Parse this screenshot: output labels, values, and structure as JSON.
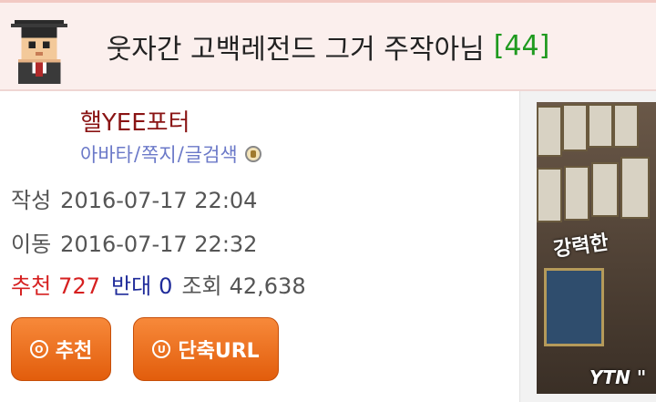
{
  "post": {
    "title": "웃자간 고백레전드 그거 주작아님",
    "comment_count": "[44]"
  },
  "author": {
    "nickname": "핼YEE포터",
    "links": [
      "아바타",
      "쪽지",
      "글검색"
    ]
  },
  "meta": {
    "written_label": "작성",
    "written": "2016-07-17 22:04",
    "moved_label": "이동",
    "moved": "2016-07-17 22:32",
    "recommend_label": "추천",
    "recommend": "727",
    "oppose_label": "반대",
    "oppose": "0",
    "views_label": "조회",
    "views": "42,638"
  },
  "buttons": {
    "recommend": "추천",
    "short_url": "단축URL"
  },
  "thumbnail": {
    "overlay_text": "강력한",
    "caption": "YTN \""
  },
  "colors": {
    "title_bg": "#fbefed",
    "count_green": "#1f9a1f",
    "nickname": "#8a1414",
    "links": "#6b79c8",
    "recommend_red": "#d62020",
    "oppose_blue": "#1f2b9a",
    "button_orange": "#ef7020"
  },
  "icons": {
    "avatar": "pixel-graduate-avatar",
    "badge": "level-badge-icon",
    "recommend_button_icon": "circle-o-icon",
    "url_button_icon": "circle-u-icon"
  }
}
